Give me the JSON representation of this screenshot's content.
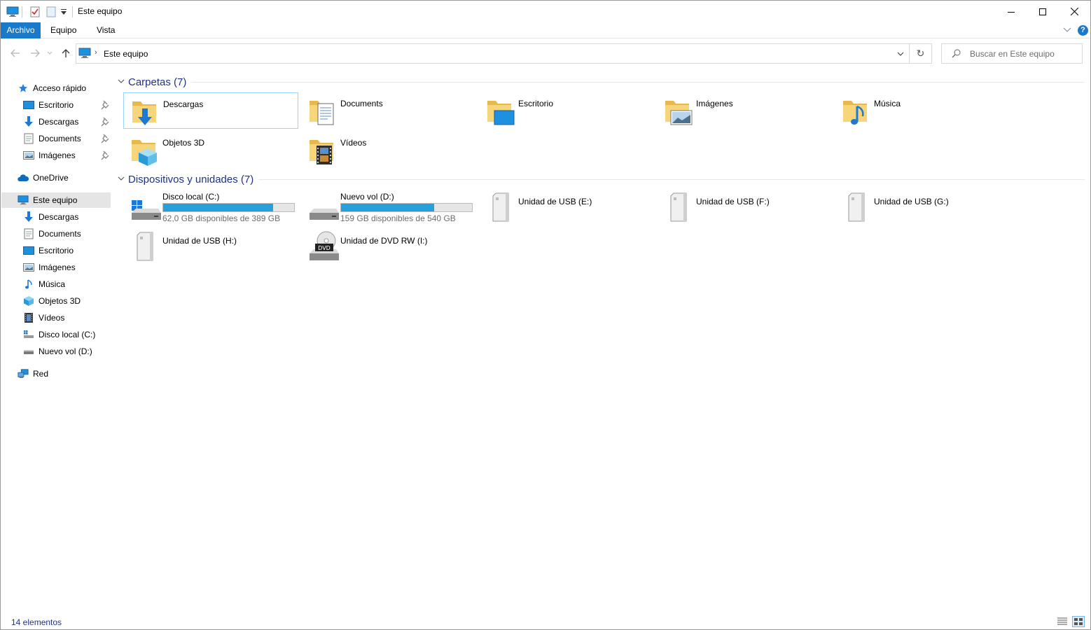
{
  "window": {
    "title": "Este equipo",
    "minimize_glyph": "–",
    "maximize_glyph": "☐",
    "close_glyph": "✕"
  },
  "ribbon": {
    "tabs": [
      "Archivo",
      "Equipo",
      "Vista"
    ],
    "help_glyph": "?"
  },
  "address": {
    "path": "Este equipo",
    "chevron": "›",
    "dropdown_glyph": "⌄",
    "refresh_glyph": "↻"
  },
  "search": {
    "placeholder": "Buscar en Este equipo"
  },
  "sidebar": {
    "quick_access": {
      "label": "Acceso rápido",
      "items": [
        "Escritorio",
        "Descargas",
        "Documents",
        "Imágenes"
      ]
    },
    "onedrive": "OneDrive",
    "this_pc": {
      "label": "Este equipo",
      "items": [
        "Descargas",
        "Documents",
        "Escritorio",
        "Imágenes",
        "Música",
        "Objetos 3D",
        "Vídeos",
        "Disco local (C:)",
        "Nuevo vol (D:)"
      ]
    },
    "network": "Red"
  },
  "main": {
    "folders": {
      "header": "Carpetas (7)",
      "items": [
        "Descargas",
        "Documents",
        "Escritorio",
        "Imágenes",
        "Música",
        "Objetos 3D",
        "Vídeos"
      ]
    },
    "devices": {
      "header": "Dispositivos y unidades (7)",
      "drives": [
        {
          "name": "Disco local (C:)",
          "free": "62,0 GB disponibles de 389 GB",
          "used_fraction": 0.84
        },
        {
          "name": "Nuevo vol (D:)",
          "free": "159 GB disponibles de 540 GB",
          "used_fraction": 0.71
        }
      ],
      "usb": [
        "Unidad de USB (E:)",
        "Unidad de USB (F:)",
        "Unidad de USB (G:)",
        "Unidad de USB (H:)"
      ],
      "dvd": {
        "name": "Unidad de DVD RW (I:)",
        "badge": "DVD"
      }
    }
  },
  "status": {
    "count": "14 elementos"
  },
  "colors": {
    "accent": "#1979ca",
    "bar_fill": "#26a0da",
    "header_text": "#1e3287"
  }
}
